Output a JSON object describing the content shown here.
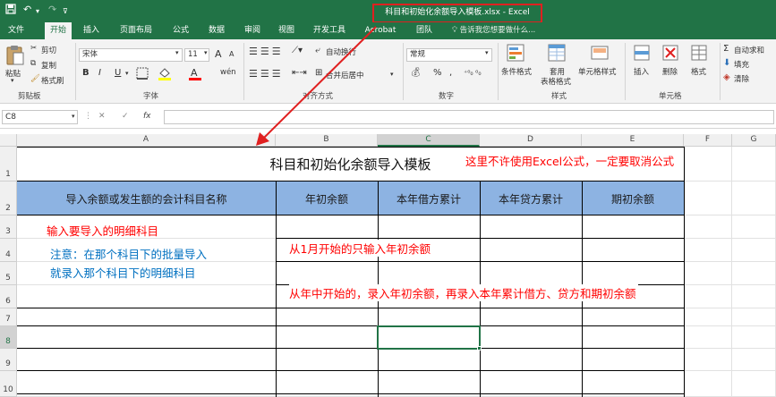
{
  "window": {
    "title": "科目和初始化余额导入模板.xlsx - Excel"
  },
  "tabs": [
    {
      "label": "文件",
      "active": false
    },
    {
      "label": "开始",
      "active": true
    },
    {
      "label": "插入",
      "active": false
    },
    {
      "label": "页面布局",
      "active": false
    },
    {
      "label": "公式",
      "active": false
    },
    {
      "label": "数据",
      "active": false
    },
    {
      "label": "审阅",
      "active": false
    },
    {
      "label": "视图",
      "active": false
    },
    {
      "label": "开发工具",
      "active": false
    },
    {
      "label": "Acrobat",
      "active": false
    },
    {
      "label": "团队",
      "active": false
    }
  ],
  "tell_me": "告诉我您想要做什么...",
  "ribbon": {
    "clipboard": {
      "paste": "粘贴",
      "cut": "剪切",
      "copy": "复制",
      "format_painter": "格式刷",
      "label": "剪贴板"
    },
    "font": {
      "name": "宋体",
      "size": "11",
      "bold": "B",
      "italic": "I",
      "underline": "U",
      "grow": "A",
      "shrink": "A",
      "label": "字体",
      "fill_color": "#ffff00",
      "font_color": "#ff0000"
    },
    "alignment": {
      "wrap": "自动换行",
      "merge": "合并后居中",
      "label": "对齐方式"
    },
    "number": {
      "format": "常规",
      "percent": "%",
      "comma": ",",
      "label": "数字"
    },
    "styles": {
      "conditional": "条件格式",
      "table_line1": "套用",
      "table_line2": "表格格式",
      "cell_styles": "单元格样式",
      "label": "样式"
    },
    "cells": {
      "insert": "插入",
      "delete": "删除",
      "format": "格式",
      "label": "单元格"
    },
    "editing": {
      "autosum": "自动求和",
      "fill": "填充",
      "clear": "清除"
    }
  },
  "formula_bar": {
    "name_box": "C8",
    "fx": "fx",
    "cancel": "✕",
    "enter": "✓",
    "value": ""
  },
  "columns": [
    "A",
    "B",
    "C",
    "D",
    "E",
    "F",
    "G"
  ],
  "rows": [
    "1",
    "2",
    "3",
    "4",
    "5",
    "6",
    "7",
    "8",
    "9",
    "10"
  ],
  "sheet": {
    "title": "科目和初始化余额导入模板",
    "headers": [
      "导入余额或发生额的会计科目名称",
      "年初余额",
      "本年借方累计",
      "本年贷方累计",
      "期初余额"
    ],
    "header_fill": "#8db3e2",
    "notes": {
      "no_formula": "这里不许使用Excel公式，一定要取消公式",
      "input_detail": "输入要导入的明细科目",
      "caution_line1": "注意：在那个科目下的批量导入",
      "caution_line2": "就录入那个科目下的明细科目",
      "jan_start": "从1月开始的只输入年初余额",
      "mid_year": "从年中开始的，录入年初余额，再录入本年累计借方、贷方和期初余额"
    },
    "note_colors": {
      "red": "#ff0000",
      "blue": "#0070c0"
    }
  },
  "selected_cell": "C8",
  "accent_color": "#217346"
}
